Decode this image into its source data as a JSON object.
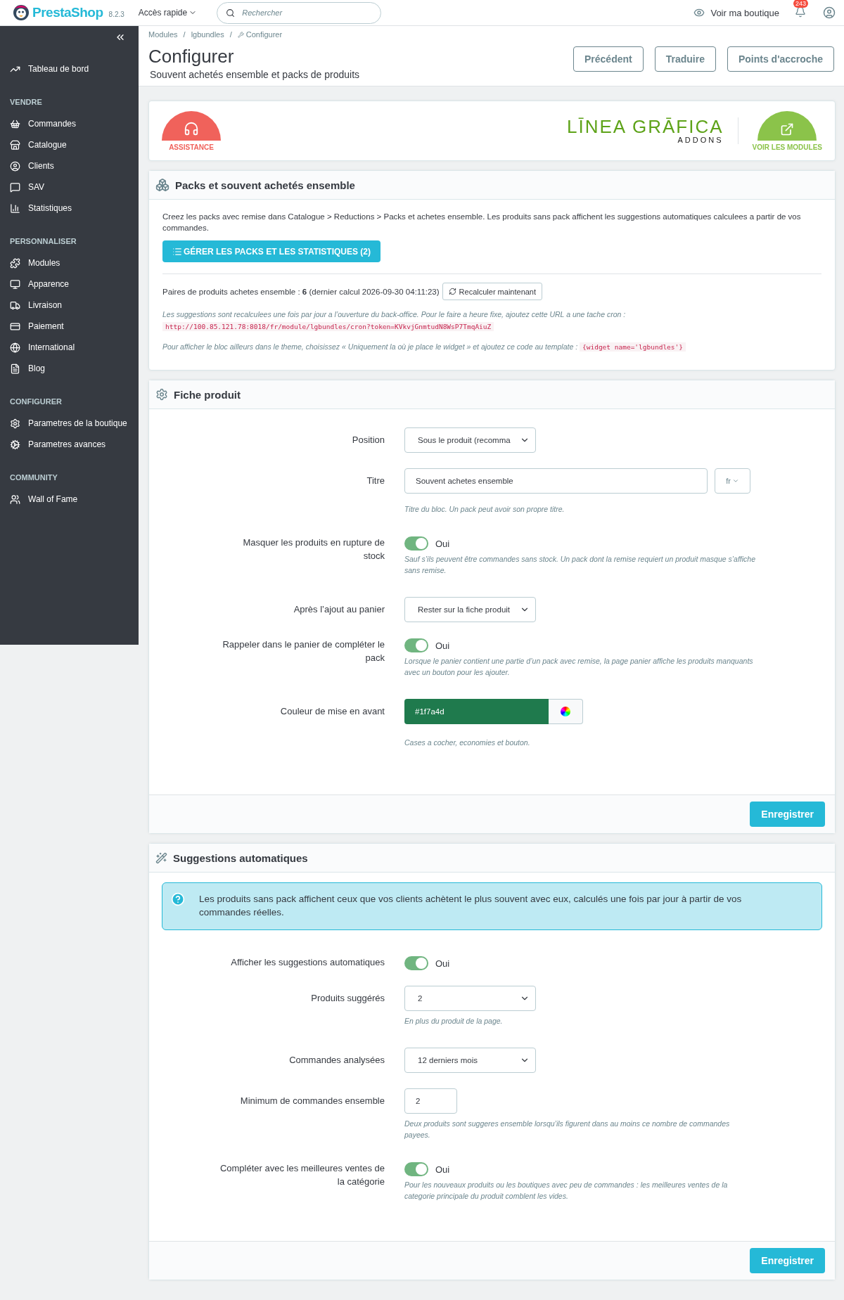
{
  "header": {
    "brand": "PrestaShop",
    "version": "8.2.3",
    "quick_access": "Accès rapide",
    "search": {
      "placeholder": "Rechercher"
    },
    "view_shop": "Voir ma boutique",
    "notifications": "243"
  },
  "sidebar": {
    "dashboard": "Tableau de bord",
    "sections": [
      {
        "title": "VENDRE",
        "items": [
          "Commandes",
          "Catalogue",
          "Clients",
          "SAV",
          "Statistiques"
        ]
      },
      {
        "title": "PERSONNALISER",
        "items": [
          "Modules",
          "Apparence",
          "Livraison",
          "Paiement",
          "International",
          "Blog"
        ]
      },
      {
        "title": "CONFIGURER",
        "items": [
          "Parametres de la boutique",
          "Parametres avances"
        ]
      },
      {
        "title": "COMMUNITY",
        "items": [
          "Wall of Fame"
        ]
      }
    ]
  },
  "breadcrumb": {
    "separator": "/",
    "items": [
      "Modules",
      "lgbundles",
      "Configurer"
    ]
  },
  "page": {
    "title": "Configurer",
    "subtitle": "Souvent achetés ensemble et packs de produits",
    "buttons": [
      "Précédent",
      "Traduire",
      "Points d'accroche"
    ]
  },
  "banner": {
    "assistance": "ASSISTANCE",
    "logo": "LĪNEA GRĀFICA",
    "logo_sub": "ADDONS",
    "modules": "VOIR LES MODULES"
  },
  "packs": {
    "title": "Packs et souvent achetés ensemble",
    "intro": "Creez les packs avec remise dans Catalogue > Reductions > Packs et achetes ensemble. Les produits sans pack affichent les suggestions automatiques calculees a partir de vos commandes.",
    "manage_button": "GÉRER LES PACKS ET LES STATISTIQUES (2)",
    "stats": "Paires de produits achetes ensemble : **6** (dernier calcul 2026-09-30 04:11:23)",
    "recalc_button": "Recalculer maintenant",
    "notes": [
      {
        "text": "Les suggestions sont recalculees une fois par jour a l’ouverture du back-office. Pour le faire a heure fixe, ajoutez cette URL a une tache cron :",
        "code": "http://100.85.121.78:8018/fr/module/lgbundles/cron?token=KVkvjGnmtudN8WsP7TmqAiuZ"
      },
      {
        "text": "Pour afficher le bloc ailleurs dans le theme, choisissez « Uniquement la où je place le widget » et ajoutez ce code au template :",
        "code": "{widget name='lgbundles'}"
      }
    ]
  },
  "product_sheet": {
    "title": "Fiche produit",
    "save": "Enregistrer",
    "fields": [
      {
        "kind": "select",
        "label": "Position",
        "value": "Sous le produit (recomma"
      },
      {
        "kind": "text",
        "label": "Titre",
        "value": "Souvent achetes ensemble",
        "lang": "fr",
        "help": "Titre du bloc. Un pack peut avoir son propre titre."
      },
      {
        "kind": "switch",
        "label": "Masquer les produits en rupture de stock",
        "on": true,
        "state_label": "Oui",
        "help": "Sauf s’ils peuvent être commandes sans stock. Un pack dont la remise requiert un produit masque s’affiche sans remise."
      },
      {
        "kind": "select",
        "label": "Après l’ajout au panier",
        "value": "Rester sur la fiche produit"
      },
      {
        "kind": "switch",
        "label": "Rappeler dans le panier de compléter le pack",
        "on": true,
        "state_label": "Oui",
        "help": "Lorsque le panier contient une partie d’un pack avec remise, la page panier affiche les produits manquants avec un bouton pour les ajouter."
      },
      {
        "kind": "color",
        "label": "Couleur de mise en avant",
        "value": "#1f7a4d",
        "help": "Cases a cocher, economies et bouton."
      }
    ]
  },
  "suggestions": {
    "title": "Suggestions automatiques",
    "save": "Enregistrer",
    "info": "Les produits sans pack affichent ceux que vos clients achètent le plus souvent avec eux, calculés une fois par jour à partir de vos commandes réelles.",
    "fields": [
      {
        "kind": "switch",
        "label": "Afficher les suggestions automatiques",
        "on": true,
        "state_label": "Oui"
      },
      {
        "kind": "select",
        "label": "Produits suggérés",
        "value": "2",
        "help": "En plus du produit de la page."
      },
      {
        "kind": "select",
        "label": "Commandes analysées",
        "value": "12 derniers mois"
      },
      {
        "kind": "number",
        "label": "Minimum de commandes ensemble",
        "value": "2",
        "help": "Deux produits sont suggeres ensemble lorsqu’ils figurent dans au moins ce nombre de commandes payees."
      },
      {
        "kind": "switch",
        "label": "Compléter avec les meilleures ventes de la catégorie",
        "on": true,
        "state_label": "Oui",
        "help": "Pour les nouveaux produits ou les boutiques avec peu de commandes : les meilleures ventes de la categorie principale du produit comblent les vides."
      }
    ]
  }
}
